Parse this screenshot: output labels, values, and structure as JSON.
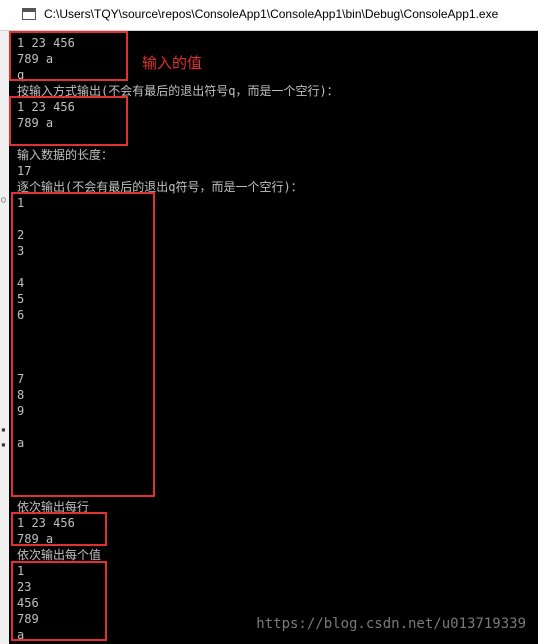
{
  "window": {
    "title": "C:\\Users\\TQY\\source\\repos\\ConsoleApp1\\ConsoleApp1\\bin\\Debug\\ConsoleApp1.exe",
    "icon": "console-window-icon"
  },
  "console": {
    "lines": [
      "1 23 456",
      "789 a",
      "q",
      "按输入方式输出(不会有最后的退出符号q，而是一个空行)：",
      "1 23 456",
      "789 a",
      "",
      "输入数据的长度：",
      "17",
      "逐个输出(不会有最后的退出q符号，而是一个空行)：",
      "1",
      "",
      "2",
      "3",
      "",
      "4",
      "5",
      "6",
      "",
      "",
      "",
      "7",
      "8",
      "9",
      "",
      "a",
      "",
      "",
      "",
      "依次输出每行",
      "1 23 456",
      "789 a",
      "依次输出每个值",
      "1",
      "23",
      "456",
      "789",
      "a"
    ]
  },
  "annotation": {
    "label": "输入的值",
    "color": "#e03030"
  },
  "watermark": "https://blog.csdn.net/u013719339",
  "colors": {
    "console_bg": "#000000",
    "console_text": "#c0c0c0",
    "highlight": "#e03030"
  }
}
